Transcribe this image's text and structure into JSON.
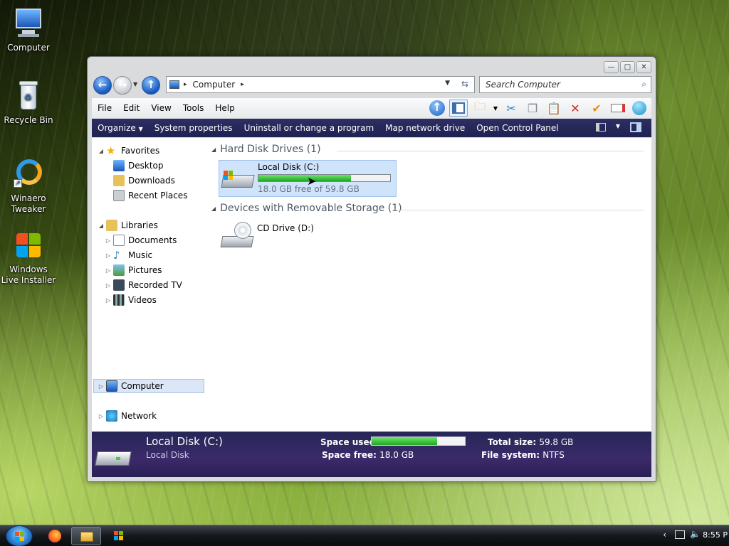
{
  "desktop": {
    "icons": [
      {
        "label": "Computer"
      },
      {
        "label": "Recycle Bin"
      },
      {
        "label": "Winaero Tweaker"
      },
      {
        "label": "Windows Live Installer"
      }
    ]
  },
  "window": {
    "address": {
      "segment": "Computer"
    },
    "search": {
      "placeholder": "Search Computer"
    },
    "menu": [
      "File",
      "Edit",
      "View",
      "Tools",
      "Help"
    ],
    "commands": [
      "Organize",
      "System properties",
      "Uninstall or change a program",
      "Map network drive",
      "Open Control Panel"
    ],
    "nav": {
      "favorites": "Favorites",
      "favorites_items": [
        "Desktop",
        "Downloads",
        "Recent Places"
      ],
      "libraries": "Libraries",
      "libraries_items": [
        "Documents",
        "Music",
        "Pictures",
        "Recorded TV",
        "Videos"
      ],
      "computer": "Computer",
      "network": "Network"
    },
    "groups": {
      "hdd_header": "Hard Disk Drives (1)",
      "removable_header": "Devices with Removable Storage (1)"
    },
    "drives": {
      "c_name": "Local Disk (C:)",
      "c_free_text": "18.0 GB free of 59.8 GB",
      "c_used_fraction": 0.7,
      "d_name": "CD Drive (D:)"
    },
    "details": {
      "title": "Local Disk (C:)",
      "subtitle": "Local Disk",
      "space_used_label": "Space used:",
      "space_used_fraction": 0.7,
      "space_free_label": "Space free:",
      "space_free_value": "18.0 GB",
      "total_size_label": "Total size:",
      "total_size_value": "59.8 GB",
      "file_system_label": "File system:",
      "file_system_value": "NTFS"
    }
  },
  "taskbar": {
    "clock": "8:55 P"
  },
  "colors": {
    "command_bar": "#1f2150",
    "details_pane": "#2f2860",
    "progress_green": "#1ea91e"
  }
}
